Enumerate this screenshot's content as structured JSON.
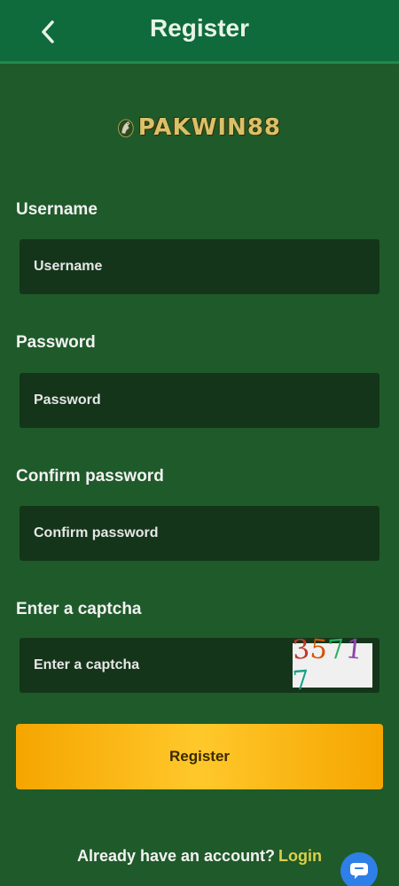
{
  "header": {
    "title": "Register",
    "back_icon": "chevron-left-icon"
  },
  "logo": {
    "text": "PAKWIN88",
    "icon": "horse-icon"
  },
  "form": {
    "username": {
      "label": "Username",
      "placeholder": "Username"
    },
    "password": {
      "label": "Password",
      "placeholder": "Password"
    },
    "confirm_password": {
      "label": "Confirm password",
      "placeholder": "Confirm password"
    },
    "captcha": {
      "label": "Enter a captcha",
      "placeholder": "Enter a captcha",
      "code": "35717"
    }
  },
  "register_button": {
    "label": "Register"
  },
  "footer": {
    "prompt": "Already have an account?",
    "login_label": "Login"
  },
  "colors": {
    "accent": "#f5a500",
    "header": "#0f6a3c",
    "background": "#1f5a2a",
    "login_link": "#d9d04a"
  }
}
